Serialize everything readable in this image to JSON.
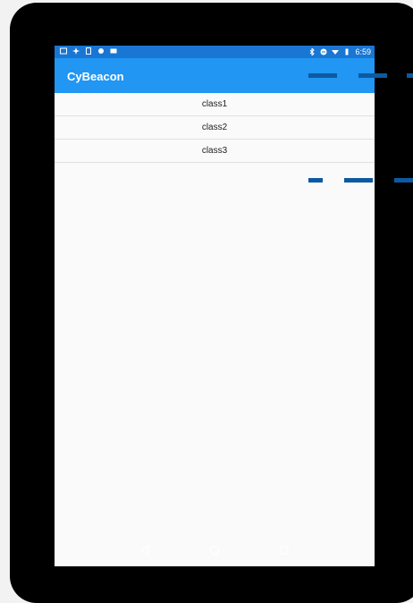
{
  "status_bar": {
    "time": "6:59",
    "left_icons": [
      "image-icon",
      "fan-icon",
      "sim-icon",
      "android-icon",
      "photo-icon"
    ],
    "right_icons": [
      "bluetooth-icon",
      "do-not-disturb-icon",
      "wifi-icon",
      "battery-icon"
    ]
  },
  "app_bar": {
    "title": "CyBeacon"
  },
  "list": {
    "items": [
      "class1",
      "class2",
      "class3"
    ]
  },
  "nav_bar": {
    "buttons": [
      "back-icon",
      "home-icon",
      "recents-icon"
    ]
  },
  "colors": {
    "status_bar": "#1976d2",
    "app_bar": "#2196f3",
    "decor_dashes": "#0d5aa0",
    "device_frame": "#000000"
  }
}
